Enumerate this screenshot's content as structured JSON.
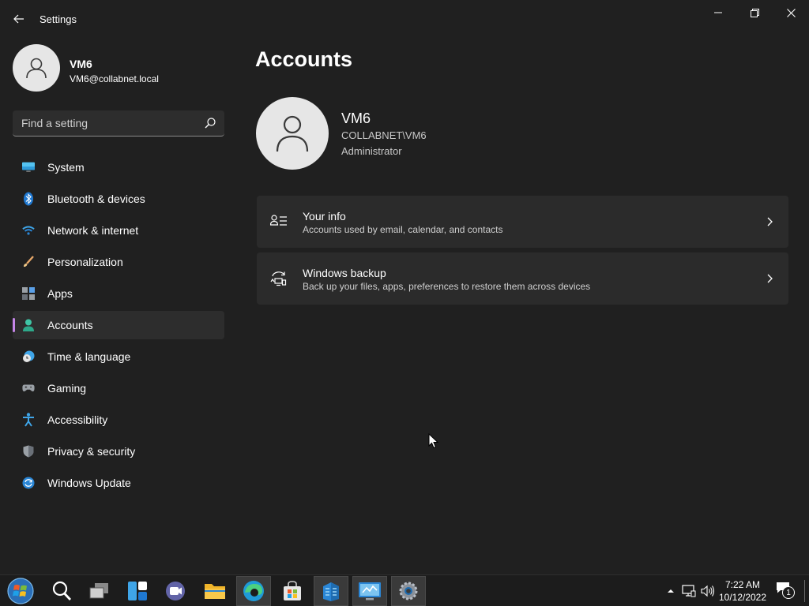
{
  "window": {
    "title": "Settings",
    "controls": [
      "minimize",
      "maximize",
      "close"
    ]
  },
  "profile": {
    "name": "VM6",
    "email": "VM6@collabnet.local"
  },
  "search": {
    "placeholder": "Find a setting"
  },
  "sidebar": {
    "items": [
      {
        "label": "System",
        "icon": "monitor-icon",
        "active": false
      },
      {
        "label": "Bluetooth & devices",
        "icon": "bluetooth-icon",
        "active": false
      },
      {
        "label": "Network & internet",
        "icon": "wifi-icon",
        "active": false
      },
      {
        "label": "Personalization",
        "icon": "brush-icon",
        "active": false
      },
      {
        "label": "Apps",
        "icon": "apps-icon",
        "active": false
      },
      {
        "label": "Accounts",
        "icon": "person-icon",
        "active": true
      },
      {
        "label": "Time & language",
        "icon": "clock-globe-icon",
        "active": false
      },
      {
        "label": "Gaming",
        "icon": "gamepad-icon",
        "active": false
      },
      {
        "label": "Accessibility",
        "icon": "accessibility-icon",
        "active": false
      },
      {
        "label": "Privacy & security",
        "icon": "shield-icon",
        "active": false
      },
      {
        "label": "Windows Update",
        "icon": "update-icon",
        "active": false
      }
    ]
  },
  "main": {
    "title": "Accounts",
    "user": {
      "name": "VM6",
      "domain": "COLLABNET\\VM6",
      "role": "Administrator"
    },
    "cards": [
      {
        "title": "Your info",
        "description": "Accounts used by email, calendar, and contacts",
        "icon": "contact-card-icon"
      },
      {
        "title": "Windows backup",
        "description": "Back up your files, apps, preferences to restore them across devices",
        "icon": "backup-sync-icon"
      }
    ]
  },
  "taskbar": {
    "apps": [
      "start-orb-icon",
      "search-icon",
      "task-view-icon",
      "widgets-icon",
      "teams-chat-icon",
      "file-explorer-icon",
      "edge-icon",
      "store-icon",
      "server-manager-icon",
      "control-panel-icon",
      "settings-icon"
    ],
    "clock": {
      "time": "7:22 AM",
      "date": "10/12/2022"
    },
    "notification_count": "1"
  },
  "colors": {
    "background": "#202020",
    "sidebar_accent": "#c586e8",
    "card": "#2b2b2b",
    "taskbar": "#1c1c1c"
  }
}
